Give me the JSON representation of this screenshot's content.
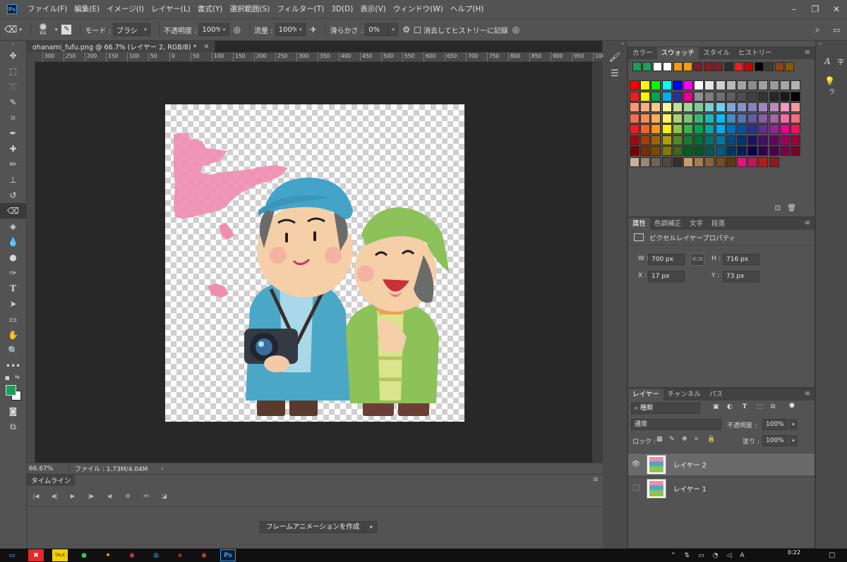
{
  "app": {
    "logo": "Ps"
  },
  "menubar": {
    "items": [
      "ファイル(F)",
      "編集(E)",
      "イメージ(I)",
      "レイヤー(L)",
      "書式(Y)",
      "選択範囲(S)",
      "フィルター(T)",
      "3D(D)",
      "表示(V)",
      "ウィンドウ(W)",
      "ヘルプ(H)"
    ]
  },
  "options": {
    "brush_size": "64",
    "mode_label": "モード :",
    "mode_value": "ブラシ",
    "opacity_label": "不透明度 :",
    "opacity_value": "100%",
    "flow_label": "流量 :",
    "flow_value": "100%",
    "smoothing_label": "滑らかさ :",
    "smoothing_value": "0%",
    "history_label": "消去してヒストリーに記録"
  },
  "document": {
    "tab_title": "ohanami_fufu.png @ 66.7% (レイヤー 2, RGB/8) *",
    "ruler_ticks": [
      "300",
      "250",
      "200",
      "150",
      "100",
      "50",
      "0",
      "50",
      "100",
      "150",
      "200",
      "250",
      "300",
      "350",
      "400",
      "450",
      "500",
      "550",
      "600",
      "650",
      "700",
      "750",
      "800",
      "850",
      "900",
      "950",
      "100"
    ]
  },
  "status": {
    "zoom": "66.67%",
    "file_info": "ファイル : 1.73M/4.04M"
  },
  "timeline": {
    "tab": "タイムライン",
    "create_button": "フレームアニメーションを作成"
  },
  "swatches_panel": {
    "tabs": [
      "カラー",
      "スウォッチ",
      "スタイル",
      "ヒストリー"
    ],
    "active_tab": "スウォッチ",
    "recent": [
      "#1a9e5a",
      "#1aa05c",
      "#ffffff",
      "#ffffff",
      "#f39c12",
      "#f39c12",
      "#7b1e2e",
      "#8b1a1a",
      "#7b1e2e",
      "#2d2d2d",
      "#ed1c24",
      "#cc0000",
      "#000000",
      "#3a3a3a",
      "#8b4513",
      "#8b5a00"
    ],
    "grid": [
      [
        "#ff0000",
        "#ffff00",
        "#00ff00",
        "#00ffff",
        "#0000ff",
        "#ff00ff",
        "#ffffff",
        "#e6e6e6",
        "#d0d0d0",
        "#b8b8b8",
        "#a3a3a3",
        "#8c8c8c",
        "#a0a0a0",
        "#999999",
        "#a6a6a6",
        "#b3b3b3"
      ],
      [
        "#ee1d24",
        "#fff200",
        "#00a651",
        "#00aeef",
        "#2e3192",
        "#ec008c",
        "#909090",
        "#7f7f7f",
        "#6f6f6f",
        "#5f5f5f",
        "#4f4f4f",
        "#404040",
        "#333333",
        "#262626",
        "#1a1a1a",
        "#000000"
      ],
      [
        "#f7977a",
        "#f9ad81",
        "#fdc68a",
        "#fff79a",
        "#c4df9b",
        "#a3d39c",
        "#82ca9d",
        "#7bcdc8",
        "#6ecff6",
        "#7ea7d8",
        "#8493ca",
        "#8882be",
        "#a187be",
        "#bc8cbf",
        "#f49ac2",
        "#f6989d"
      ],
      [
        "#f26c4f",
        "#f68e55",
        "#fbaf5c",
        "#fff467",
        "#acd372",
        "#7cc576",
        "#3bb878",
        "#1abbb4",
        "#00bff3",
        "#438ccb",
        "#5574b9",
        "#605ca8",
        "#855fa8",
        "#a763a8",
        "#f06ea9",
        "#f26d7d"
      ],
      [
        "#ed1c24",
        "#f26522",
        "#f7941d",
        "#fff200",
        "#8dc73f",
        "#39b54a",
        "#00a651",
        "#00a99d",
        "#00aeef",
        "#0072bc",
        "#0054a6",
        "#2e3192",
        "#662d91",
        "#92278f",
        "#ec008c",
        "#ed145b"
      ],
      [
        "#9e0b0f",
        "#a0410d",
        "#a36209",
        "#aba000",
        "#598527",
        "#1a7b30",
        "#007236",
        "#00746b",
        "#0076a3",
        "#004b80",
        "#003471",
        "#1b1464",
        "#440e62",
        "#630460",
        "#9e005d",
        "#9e0039"
      ],
      [
        "#790000",
        "#7b2e00",
        "#7d4900",
        "#827b00",
        "#406618",
        "#005e20",
        "#005826",
        "#005952",
        "#005b7f",
        "#003663",
        "#002157",
        "#0d004c",
        "#32004b",
        "#4b0049",
        "#7b0046",
        "#7a0026"
      ],
      [
        "#c7b299",
        "#998675",
        "#736357",
        "#534741",
        "#362f2d",
        "#c69c6d",
        "#a67c52",
        "#8c6239",
        "#754c24",
        "#603913",
        "#ed0f7a",
        "#c2185b",
        "#b71c1c",
        "#8b1a1a"
      ]
    ]
  },
  "properties_panel": {
    "tabs": [
      "属性",
      "色調補正",
      "文字",
      "段落"
    ],
    "active_tab": "属性",
    "title": "ピクセルレイヤープロパティ",
    "w_label": "W :",
    "w_value": "700 px",
    "h_label": "H :",
    "h_value": "716 px",
    "x_label": "X :",
    "x_value": "17 px",
    "y_label": "Y :",
    "y_value": "73 px"
  },
  "layers_panel": {
    "tabs": [
      "レイヤー",
      "チャンネル",
      "パス"
    ],
    "active_tab": "レイヤー",
    "filter": "種類",
    "blend": "通常",
    "opacity_label": "不透明度 :",
    "opacity_value": "100%",
    "lock_label": "ロック :",
    "fill_label": "塗り :",
    "fill_value": "100%",
    "layers": [
      {
        "name": "レイヤー 2",
        "visible": true,
        "selected": true
      },
      {
        "name": "レイヤー 1",
        "visible": false,
        "selected": false
      }
    ]
  },
  "right_dock": {
    "items": [
      "字",
      "ラ"
    ]
  },
  "taskbar": {
    "time": "0:22"
  },
  "colors": {
    "foreground": "#1a9e5a",
    "background": "#ffffff"
  }
}
